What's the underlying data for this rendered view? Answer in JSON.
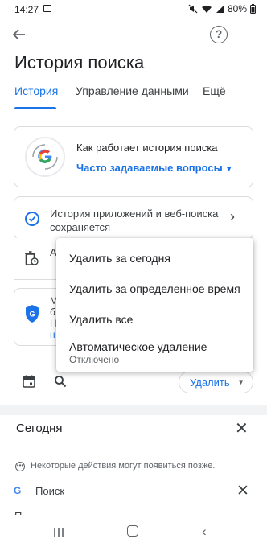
{
  "status_bar": {
    "time": "14:27",
    "battery": "80%"
  },
  "header": {
    "title": "История поиска"
  },
  "tabs": [
    {
      "label": "История",
      "active": true
    },
    {
      "label": "Управление данными",
      "active": false
    },
    {
      "label": "Ещё",
      "active": false
    }
  ],
  "info_card": {
    "title": "Как работает история поиска",
    "link": "Часто задаваемые вопросы"
  },
  "activity_row": {
    "text": "История приложений и веб-поиска сохраняется"
  },
  "autodelete_row": {
    "partial": "А"
  },
  "protection_card": {
    "partial_line1": "М",
    "partial_line2": "б",
    "partial_link": "Н",
    "partial_line4": "н"
  },
  "toolbar": {
    "delete_label": "Удалить"
  },
  "popup_menu": {
    "items": [
      {
        "label": "Удалить за сегодня"
      },
      {
        "label": "Удалить за определенное время"
      },
      {
        "label": "Удалить все"
      },
      {
        "label": "Автоматическое удаление",
        "sublabel": "Отключено"
      }
    ]
  },
  "today_section": {
    "title": "Сегодня",
    "info": "Некоторые действия могут появиться позже.",
    "entry_label": "Поиск",
    "entry_icon": "G",
    "cut_text": "П"
  },
  "colors": {
    "accent": "#1a73e8",
    "text": "#202124",
    "secondary": "#5f6368"
  }
}
